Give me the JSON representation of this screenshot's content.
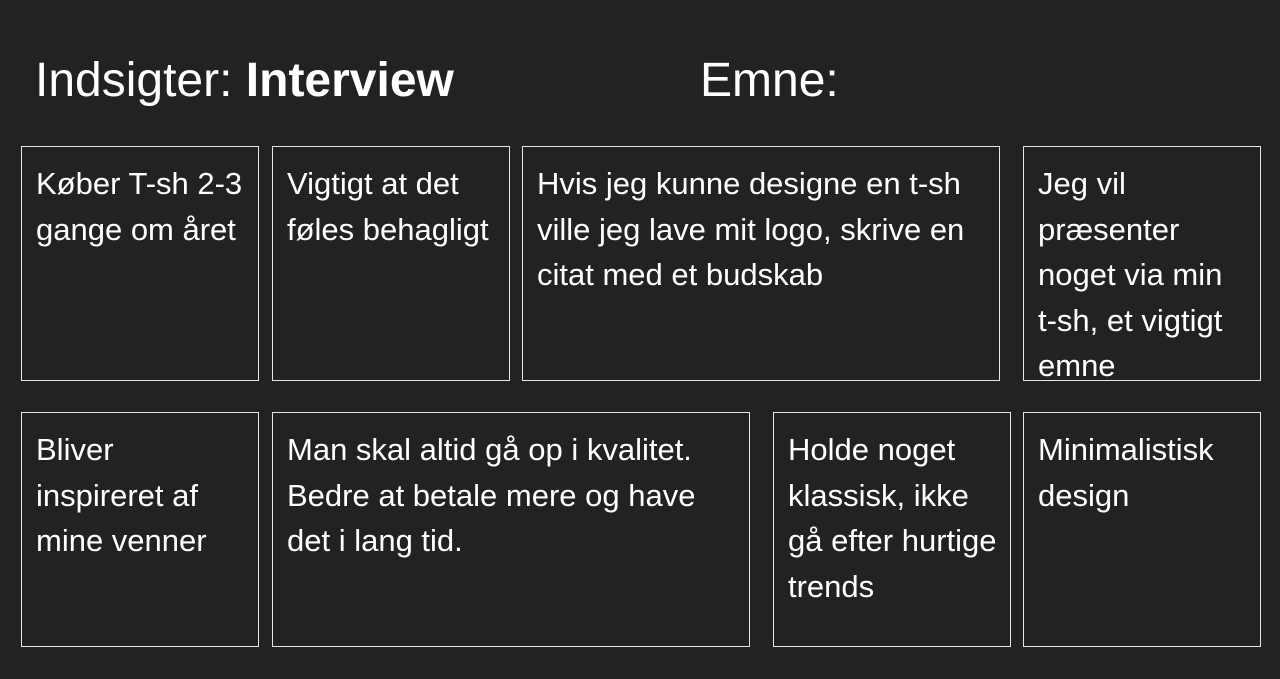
{
  "header": {
    "title_prefix": "Indsigter: ",
    "title_emphasis": "Interview",
    "topic_label": "Emne:"
  },
  "cards": [
    {
      "text": "Køber T-sh 2-3 gange om året"
    },
    {
      "text": "Vigtigt at det føles behagligt"
    },
    {
      "text": "Hvis jeg kunne designe en t-sh ville jeg lave mit logo, skrive en citat med et budskab"
    },
    {
      "text": "Jeg vil præsenter noget via min t-sh, et vigtigt emne"
    },
    {
      "text": "Bliver inspireret af mine venner"
    },
    {
      "text": "Man skal altid gå op i kvalitet. Bedre at betale mere og have det i lang tid."
    },
    {
      "text": "Holde noget klassisk, ikke gå efter hurtige trends"
    },
    {
      "text": "Minimalistisk design"
    }
  ],
  "colors": {
    "background": "#222222",
    "text": "#ffffff",
    "card_border": "#e6e6e6"
  }
}
